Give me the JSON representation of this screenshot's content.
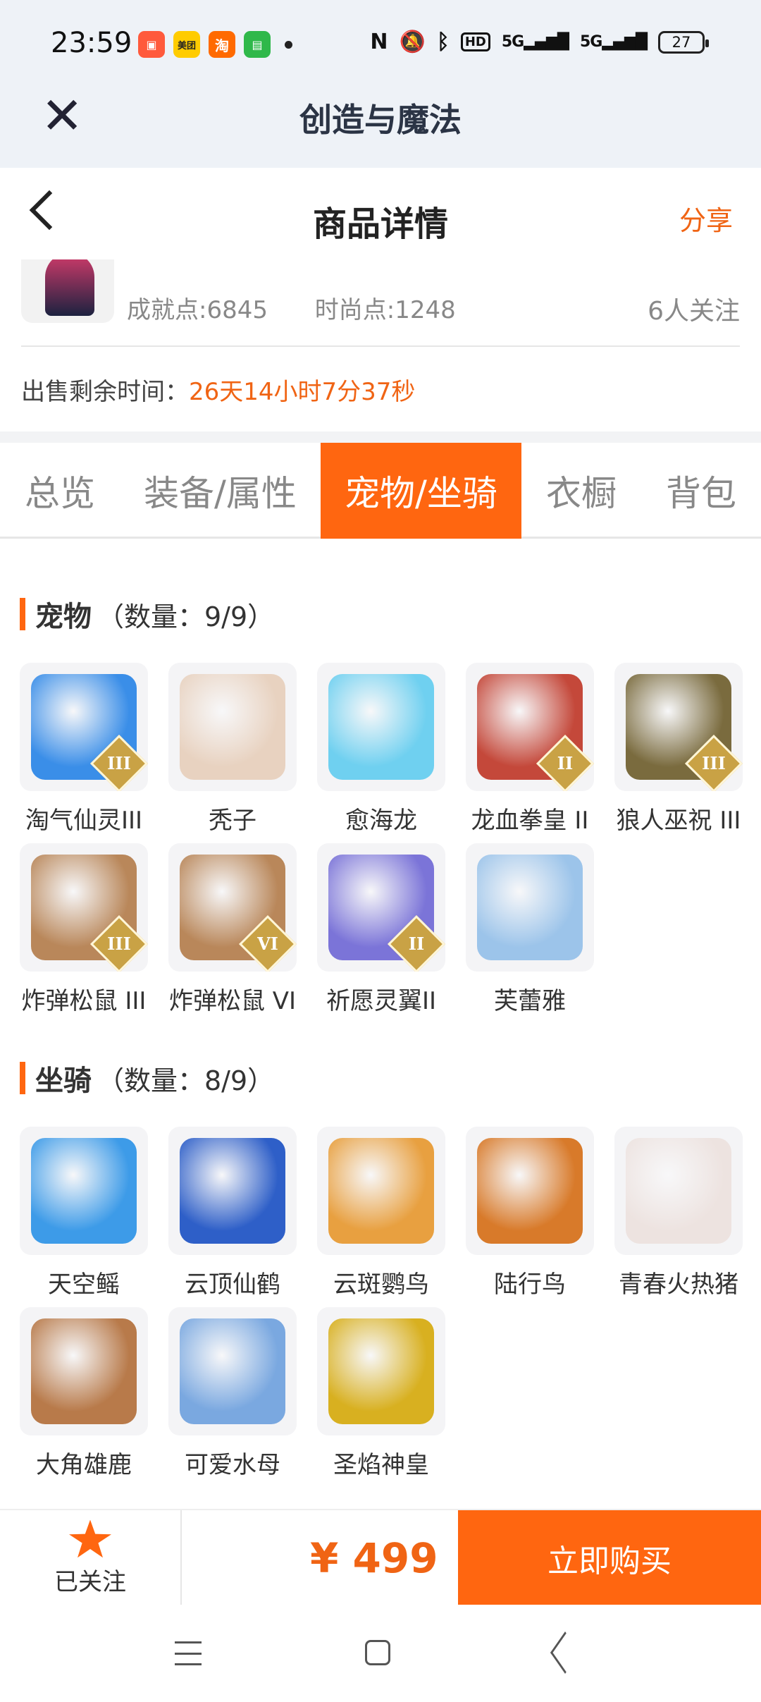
{
  "status_bar": {
    "time": "23:59",
    "network": "5G",
    "network2": "5G",
    "hd": "HD",
    "battery": "27",
    "apps": [
      "美团",
      "淘"
    ]
  },
  "app_header": {
    "title": "创造与魔法"
  },
  "page_nav": {
    "title": "商品详情",
    "share": "分享"
  },
  "product": {
    "achievement": "成就点:6845",
    "fashion": "时尚点:1248",
    "followers": "6人关注"
  },
  "sale": {
    "label": "出售剩余时间：",
    "value": "26天14小时7分37秒"
  },
  "tabs": [
    {
      "label": "总览",
      "active": false
    },
    {
      "label": "装备/属性",
      "active": false
    },
    {
      "label": "宠物/坐骑",
      "active": true
    },
    {
      "label": "衣橱",
      "active": false
    },
    {
      "label": "背包",
      "active": false
    }
  ],
  "pets": {
    "title": "宠物",
    "count": "（数量：9/9）",
    "items": [
      {
        "name": "淘气仙灵III",
        "rank": "III",
        "color": "#3a8ee8"
      },
      {
        "name": "秃子",
        "rank": "",
        "color": "#e8d2c0"
      },
      {
        "name": "愈海龙",
        "rank": "",
        "color": "#6fd0f0"
      },
      {
        "name": "龙血拳皇 II",
        "rank": "II",
        "color": "#c4483a"
      },
      {
        "name": "狼人巫祝 III",
        "rank": "III",
        "color": "#7a6b3e"
      },
      {
        "name": "炸弹松鼠 III",
        "rank": "III",
        "color": "#b9875a"
      },
      {
        "name": "炸弹松鼠 VI",
        "rank": "VI",
        "color": "#b9875a"
      },
      {
        "name": "祈愿灵翼II",
        "rank": "II",
        "color": "#7b74d8"
      },
      {
        "name": "芙蕾雅",
        "rank": "",
        "color": "#9cc4ea"
      }
    ]
  },
  "mounts": {
    "title": "坐骑",
    "count": "（数量：8/9）",
    "items": [
      {
        "name": "天空鳐",
        "color": "#3d9be8"
      },
      {
        "name": "云顶仙鹤",
        "color": "#2e5fc8"
      },
      {
        "name": "云斑鹦鸟",
        "color": "#e8a040"
      },
      {
        "name": "陆行鸟",
        "color": "#d87a2a"
      },
      {
        "name": "青春火热猪",
        "color": "#ede3e0"
      },
      {
        "name": "大角雄鹿",
        "color": "#b87a4a"
      },
      {
        "name": "可爱水母",
        "color": "#7aa8e0"
      },
      {
        "name": "圣焰神皇",
        "color": "#d8b020"
      }
    ]
  },
  "bottom": {
    "followed": "已关注",
    "price": "¥ 499",
    "buy": "立即购买"
  }
}
